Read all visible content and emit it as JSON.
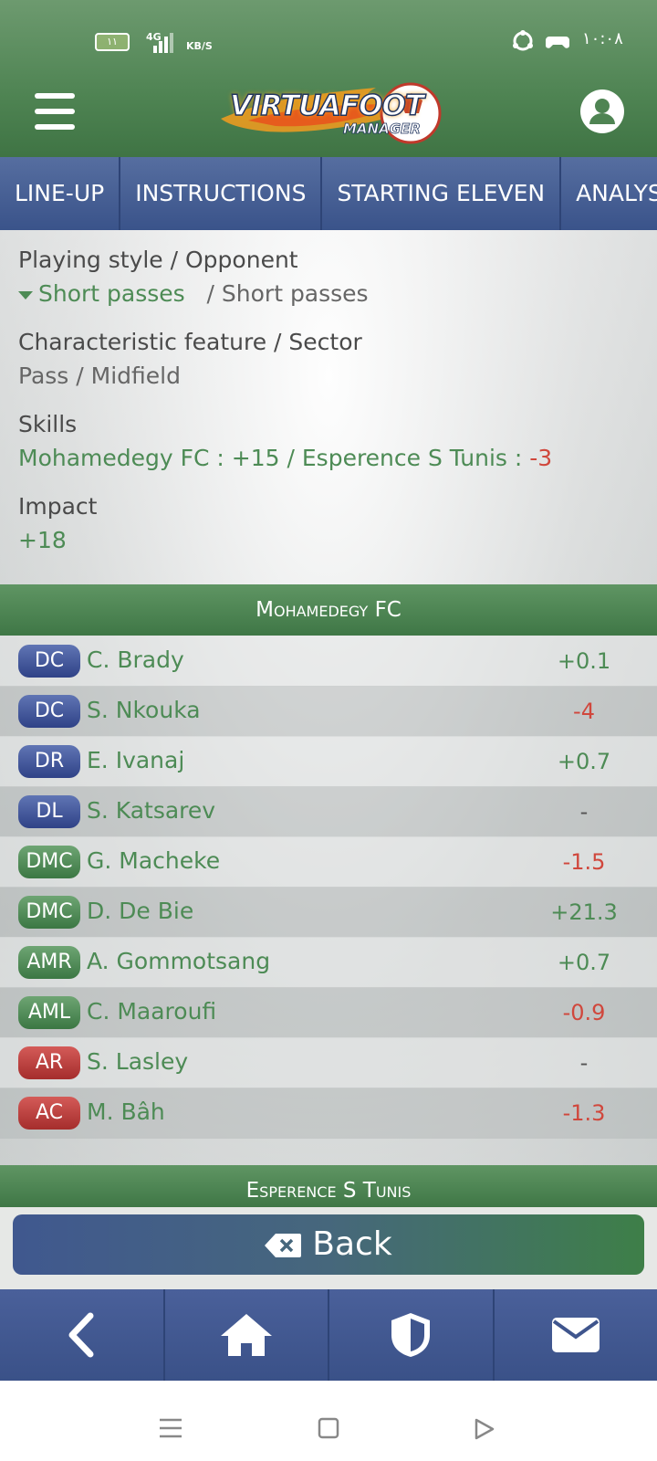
{
  "status_bar": {
    "battery": "١١",
    "network": "4G",
    "speed_unit": "KB/S",
    "time": "١٠:٠٨"
  },
  "header": {
    "logo_line1": "VIRTUAFOOT",
    "logo_line2": "MANAGER"
  },
  "tabs": [
    {
      "label": "LINE-UP"
    },
    {
      "label": "INSTRUCTIONS"
    },
    {
      "label": "STARTING ELEVEN"
    },
    {
      "label": "ANALYSIS"
    }
  ],
  "analysis": {
    "playing_style": {
      "label": "Playing style / Opponent",
      "own": "Short passes",
      "opponent": "/ Short passes"
    },
    "characteristic": {
      "label": "Characteristic feature / Sector",
      "value": "Pass / Midfield"
    },
    "skills": {
      "label": "Skills",
      "team1": "Mohamedegy FC : +15",
      "separator": " / ",
      "team2": "Esperence S Tunis : ",
      "team2_value": "-3"
    },
    "impact": {
      "label": "Impact",
      "value": "+18"
    }
  },
  "team1": {
    "name": "Mohamedegy FC",
    "players": [
      {
        "pos": "DC",
        "name": "C. Brady",
        "value": "+0.1"
      },
      {
        "pos": "DC",
        "name": "S. Nkouka",
        "value": "-4"
      },
      {
        "pos": "DR",
        "name": "E. Ivanaj",
        "value": "+0.7"
      },
      {
        "pos": "DL",
        "name": "S. Katsarev",
        "value": "-"
      },
      {
        "pos": "DMC",
        "name": "G. Macheke",
        "value": "-1.5"
      },
      {
        "pos": "DMC",
        "name": "D. De Bie",
        "value": "+21.3"
      },
      {
        "pos": "AMR",
        "name": "A. Gommotsang",
        "value": "+0.7"
      },
      {
        "pos": "AML",
        "name": "C. Maaroufi",
        "value": "-0.9"
      },
      {
        "pos": "AR",
        "name": "S. Lasley",
        "value": "-"
      },
      {
        "pos": "AC",
        "name": "M. Bâh",
        "value": "-1.3"
      }
    ]
  },
  "team2": {
    "name": "Esperence S Tunis"
  },
  "back_button": {
    "label": "Back"
  },
  "colors": {
    "header_green": "#4f8453",
    "tab_blue": "#3a538a",
    "positive": "#4d8b55",
    "negative": "#d0473c"
  }
}
